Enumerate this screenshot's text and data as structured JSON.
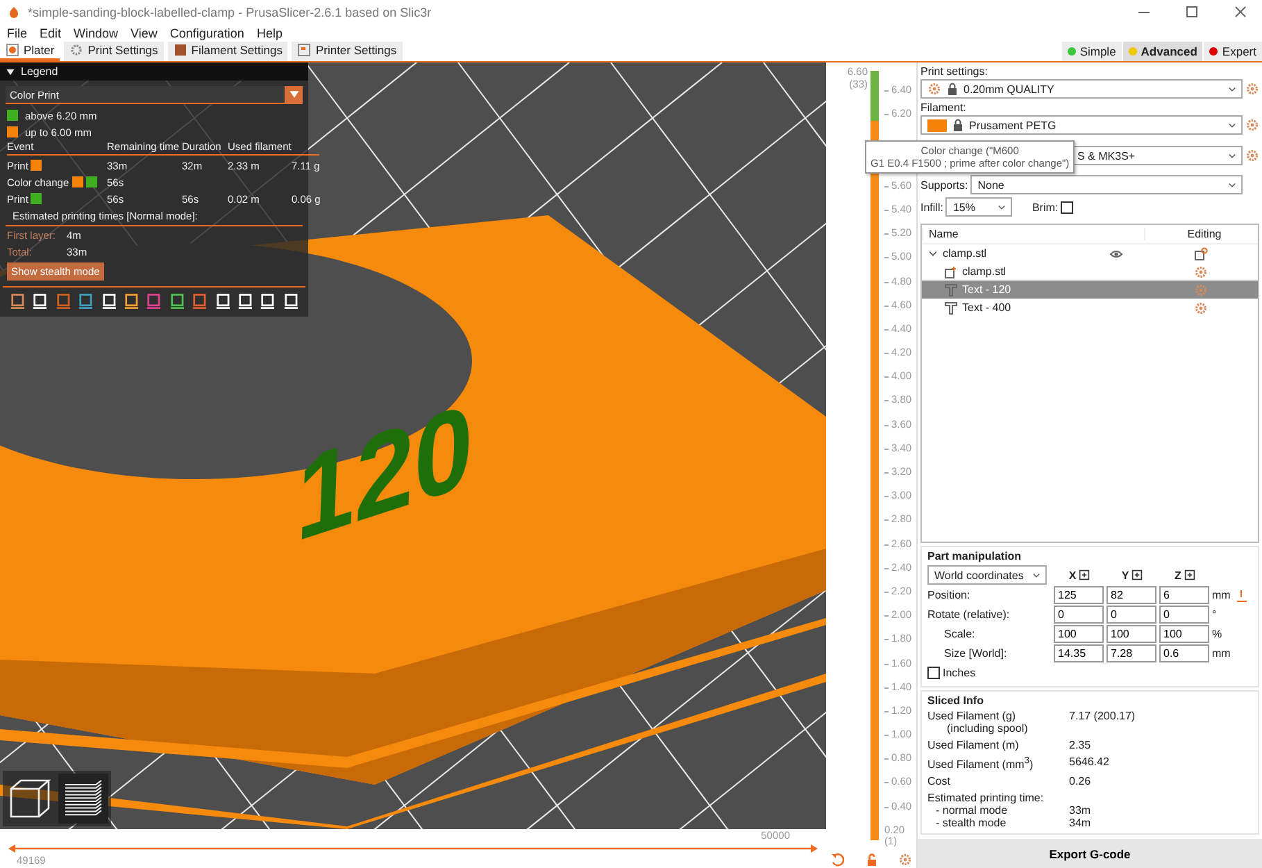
{
  "window": {
    "title": "*simple-sanding-block-labelled-clamp - PrusaSlicer-2.6.1 based on Slic3r"
  },
  "menu": [
    "File",
    "Edit",
    "Window",
    "View",
    "Configuration",
    "Help"
  ],
  "tabs": [
    {
      "label": "Plater",
      "selected": true
    },
    {
      "label": "Print Settings",
      "selected": false
    },
    {
      "label": "Filament Settings",
      "selected": false
    },
    {
      "label": "Printer Settings",
      "selected": false
    }
  ],
  "modes": [
    {
      "label": "Simple",
      "color": "#3cc83c",
      "selected": false
    },
    {
      "label": "Advanced",
      "color": "#f0c800",
      "selected": true
    },
    {
      "label": "Expert",
      "color": "#e00000",
      "selected": false
    }
  ],
  "legend": {
    "title": "Legend",
    "expanded": true,
    "view_type": "Color Print",
    "ranges": [
      {
        "label": "above 6.20 mm",
        "color": "#3fae1f"
      },
      {
        "label": "up to 6.00 mm",
        "color": "#f5820a"
      }
    ],
    "columns": [
      "Event",
      "Remaining time",
      "Duration",
      "Used filament"
    ],
    "events": [
      {
        "event": "Print",
        "swatches": [
          {
            "color": "#f5820a"
          }
        ],
        "remaining": "33m",
        "duration": "32m",
        "length": "2.33 m",
        "weight": "7.11 g"
      },
      {
        "event": "Color change",
        "swatches": [
          {
            "color": "#f5820a"
          },
          {
            "color": "#3fae1f"
          }
        ],
        "remaining": "56s"
      },
      {
        "event": "Print",
        "swatches": [
          {
            "color": "#3fae1f"
          }
        ],
        "remaining": "56s",
        "duration": "56s",
        "length": "0.02 m",
        "weight": "0.06 g"
      }
    ],
    "estimate_title": "Estimated printing times [Normal mode]:",
    "times": [
      {
        "label": "First layer:",
        "value": "4m"
      },
      {
        "label": "Total:",
        "value": "33m"
      }
    ],
    "stealth_button": "Show stealth mode"
  },
  "model_label": "120",
  "horizontal_slider": {
    "level": 1,
    "min_label": "49169",
    "max_label": "50000"
  },
  "vertical_slider": {
    "level": 1,
    "top_value": "6.60",
    "top_layer": "(33)",
    "bottom_value": "0.20",
    "bottom_layer": "(1)",
    "ticks_upper": [
      "6.40",
      "6.20"
    ],
    "ticks_lower": [
      "5.60",
      "5.40",
      "5.20",
      "5.00",
      "4.80",
      "4.60",
      "4.40",
      "4.20",
      "4.00",
      "3.80",
      "3.60",
      "3.40",
      "3.20",
      "3.00",
      "2.80",
      "2.60",
      "2.40",
      "2.20",
      "2.00",
      "1.80",
      "1.60",
      "1.40",
      "1.20",
      "1.00",
      "0.80",
      "0.60",
      "0.40"
    ]
  },
  "tooltip": [
    "Color change (\"M600",
    "G1 E0.4 F1500 ; prime after color change\")"
  ],
  "settings": {
    "print_label": "Print settings:",
    "print_value": "0.20mm QUALITY",
    "filament_label": "Filament:",
    "filament_value": "Prusament PETG",
    "filament_swatch": {
      "color": "#f5820a"
    },
    "printer_value": "S & MK3S+",
    "supports_label": "Supports:",
    "supports_value": "None",
    "infill_label": "Infill:",
    "infill_value": "15%",
    "brim_label": "Brim:",
    "brim_checked": false
  },
  "object_list": {
    "columns": [
      "Name",
      "Editing"
    ],
    "items": [
      {
        "name": "clamp.stl",
        "expanded": true,
        "selected": false,
        "children": [
          {
            "name": "clamp.stl",
            "kind": "part",
            "selected": false
          },
          {
            "name": "Text - 120",
            "kind": "text",
            "selected": true
          },
          {
            "name": "Text - 400",
            "kind": "text",
            "selected": false
          }
        ]
      }
    ]
  },
  "part_manipulation": {
    "title": "Part manipulation",
    "coordinates": "World coordinates",
    "axes": [
      "X",
      "Y",
      "Z"
    ],
    "rows": [
      {
        "label": "Position:",
        "values": [
          "125",
          "82",
          "6"
        ],
        "unit": "mm"
      },
      {
        "label": "Rotate (relative):",
        "values": [
          "0",
          "0",
          "0"
        ],
        "unit": "°"
      },
      {
        "label": "Scale:",
        "values": [
          "100",
          "100",
          "100"
        ],
        "unit": "%"
      },
      {
        "label": "Size [World]:",
        "values": [
          "14.35",
          "7.28",
          "0.6"
        ],
        "unit": "mm"
      }
    ],
    "inches_label": "Inches",
    "inches_checked": false
  },
  "sliced_info": {
    "title": "Sliced Info",
    "rows": [
      {
        "label": "Used Filament (g)",
        "sub": "(including spool)",
        "value": "7.17 (200.17)"
      },
      {
        "label": "Used Filament (m)",
        "value": "2.35"
      },
      {
        "label": "Used Filament (mm$^{3}$)",
        "value": "5646.42"
      },
      {
        "label": "Cost",
        "value": "0.26"
      }
    ],
    "time_title": "Estimated printing time:",
    "times": [
      {
        "label": "- normal mode",
        "value": "33m"
      },
      {
        "label": "- stealth mode",
        "value": "34m"
      }
    ]
  },
  "export_button": "Export G-code"
}
